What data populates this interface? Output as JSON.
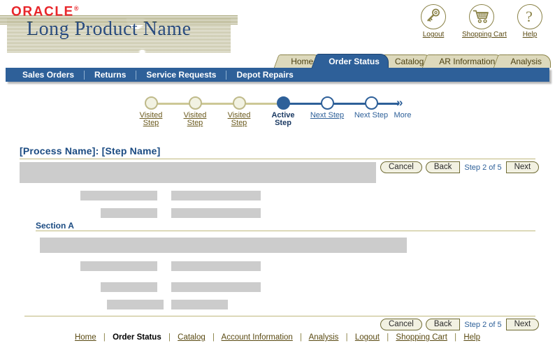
{
  "header": {
    "logo_text": "ORACLE",
    "logo_tick": "®",
    "product_name": "Long Product Name",
    "global_icons": [
      {
        "name": "key-icon",
        "label": "Logout"
      },
      {
        "name": "shopping-cart-icon",
        "label": "Shopping Cart"
      },
      {
        "name": "question-mark-icon",
        "label": "Help"
      }
    ]
  },
  "tabs": [
    {
      "label": "Home",
      "active": false
    },
    {
      "label": "Order Status",
      "active": true
    },
    {
      "label": "Catalog",
      "active": false
    },
    {
      "label": "AR Information",
      "active": false
    },
    {
      "label": "Analysis",
      "active": false
    }
  ],
  "menu": [
    {
      "label": "Sales Orders"
    },
    {
      "label": "Returns"
    },
    {
      "label": "Service Requests"
    },
    {
      "label": "Depot Repairs"
    }
  ],
  "train": {
    "steps": [
      {
        "label_line1": "Visited",
        "label_line2": "Step",
        "state": "visited"
      },
      {
        "label_line1": "Visited",
        "label_line2": "Step",
        "state": "visited"
      },
      {
        "label_line1": "Visited",
        "label_line2": "Step",
        "state": "visited"
      },
      {
        "label_line1": "Active",
        "label_line2": "Step",
        "state": "active"
      },
      {
        "label_line1": "Next Step",
        "label_line2": "",
        "state": "next-link"
      },
      {
        "label_line1": "Next Step",
        "label_line2": "",
        "state": "next"
      }
    ],
    "more_label": "More",
    "more_icon": "double-chevron-right-icon"
  },
  "content": {
    "page_title": "[Process Name]: [Step Name]",
    "section_a_title": "Section A"
  },
  "actions": {
    "cancel_label": "Cancel",
    "back_label": "Back",
    "next_label": "Next",
    "step_count": "Step 2 of 5"
  },
  "footer": {
    "links": [
      {
        "label": "Home",
        "current": false
      },
      {
        "label": "Order Status",
        "current": true
      },
      {
        "label": "Catalog",
        "current": false
      },
      {
        "label": "Account Information",
        "current": false
      },
      {
        "label": "Analysis",
        "current": false
      },
      {
        "label": "Logout",
        "current": false
      },
      {
        "label": "Shopping Cart",
        "current": false
      },
      {
        "label": "Help",
        "current": false
      }
    ],
    "separator": "|"
  },
  "colors": {
    "oracle_red": "#e8262b",
    "brand_blue": "#2e6099",
    "olive": "#8a8247",
    "tab_khaki": "#ddd9bc",
    "placeholder_gray": "#cccccc",
    "title_blue": "#1b4b82"
  }
}
